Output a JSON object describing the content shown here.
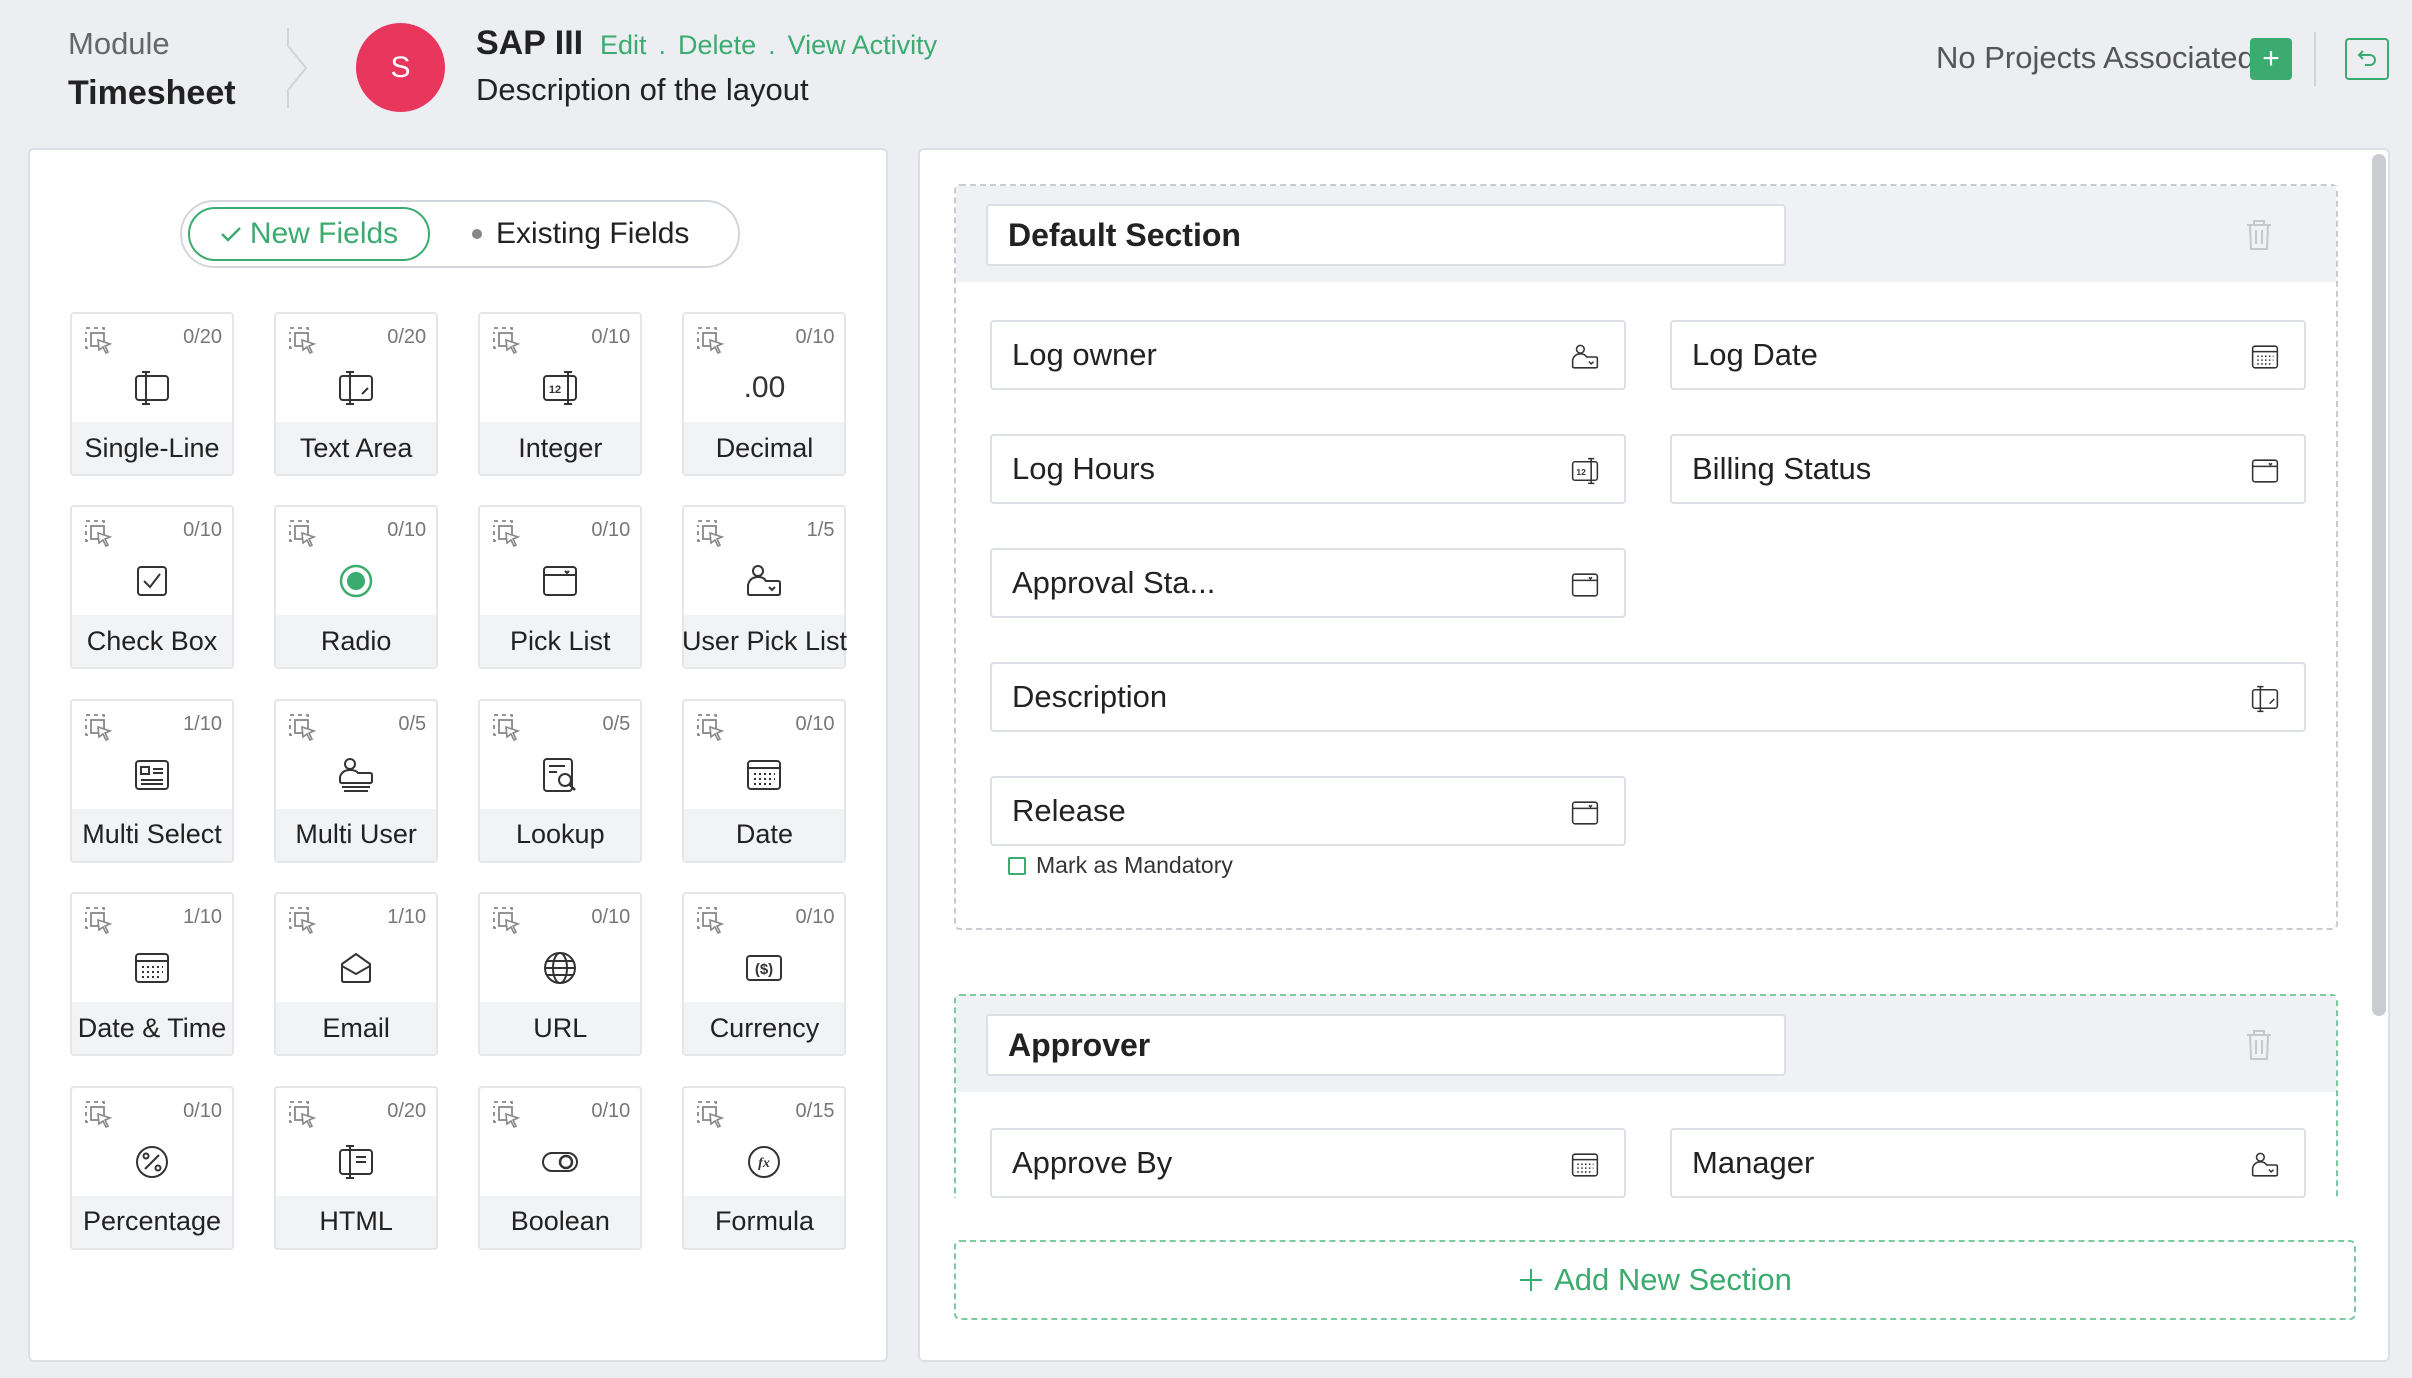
{
  "header": {
    "module_label": "Module",
    "module_name": "Timesheet",
    "avatar_letter": "S",
    "layout_name": "SAP III",
    "actions": [
      "Edit",
      "Delete",
      "View Activity"
    ],
    "separator": ".",
    "description": "Description of the layout",
    "no_projects": "No Projects Associated",
    "add_project_symbol": "+"
  },
  "field_palette": {
    "tab_new": "New Fields",
    "tab_existing": "Existing Fields",
    "active_tab": "New Fields",
    "items": [
      {
        "label": "Single-Line",
        "count": "0/20",
        "icon": "single-line-icon"
      },
      {
        "label": "Text Area",
        "count": "0/20",
        "icon": "text-area-icon"
      },
      {
        "label": "Integer",
        "count": "0/10",
        "icon": "integer-icon"
      },
      {
        "label": "Decimal",
        "count": "0/10",
        "icon": "decimal-icon",
        "glyph": ".00"
      },
      {
        "label": "Check Box",
        "count": "0/10",
        "icon": "checkbox-icon"
      },
      {
        "label": "Radio",
        "count": "0/10",
        "icon": "radio-icon"
      },
      {
        "label": "Pick List",
        "count": "0/10",
        "icon": "picklist-icon"
      },
      {
        "label": "User Pick List",
        "count": "1/5",
        "icon": "user-picklist-icon"
      },
      {
        "label": "Multi Select",
        "count": "1/10",
        "icon": "multi-select-icon"
      },
      {
        "label": "Multi User",
        "count": "0/5",
        "icon": "multi-user-icon"
      },
      {
        "label": "Lookup",
        "count": "0/5",
        "icon": "lookup-icon"
      },
      {
        "label": "Date",
        "count": "0/10",
        "icon": "date-icon"
      },
      {
        "label": "Date & Time",
        "count": "1/10",
        "icon": "date-time-icon"
      },
      {
        "label": "Email",
        "count": "1/10",
        "icon": "email-icon"
      },
      {
        "label": "URL",
        "count": "0/10",
        "icon": "url-icon"
      },
      {
        "label": "Currency",
        "count": "0/10",
        "icon": "currency-icon"
      },
      {
        "label": "Percentage",
        "count": "0/10",
        "icon": "percentage-icon"
      },
      {
        "label": "HTML",
        "count": "0/20",
        "icon": "html-icon"
      },
      {
        "label": "Boolean",
        "count": "0/10",
        "icon": "boolean-icon"
      },
      {
        "label": "Formula",
        "count": "0/15",
        "icon": "formula-icon"
      }
    ]
  },
  "layout": {
    "sections": [
      {
        "title": "Default Section",
        "fields": [
          {
            "label": "Log owner",
            "icon": "user-picklist-icon"
          },
          {
            "label": "Log Date",
            "icon": "date-icon"
          },
          {
            "label": "Log Hours",
            "icon": "integer-icon"
          },
          {
            "label": "Billing Status",
            "icon": "picklist-icon"
          },
          {
            "label": "Approval Sta...",
            "icon": "picklist-icon"
          },
          {
            "label": "Description",
            "icon": "text-area-icon"
          },
          {
            "label": "Release",
            "icon": "picklist-icon"
          }
        ],
        "mandatory_label": "Mark as Mandatory"
      },
      {
        "title": "Approver",
        "fields": [
          {
            "label": "Approve By",
            "icon": "date-icon"
          },
          {
            "label": "Manager",
            "icon": "user-picklist-icon"
          }
        ]
      }
    ],
    "add_section_label": "Add New Section"
  },
  "colors": {
    "accent": "#3bab6f",
    "avatar": "#e8365d",
    "background": "#eceef2"
  }
}
